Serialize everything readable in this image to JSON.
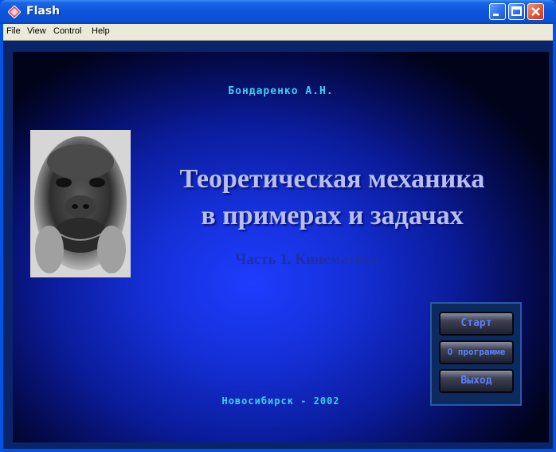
{
  "window": {
    "title": "Flash",
    "icon": "flash-app-icon",
    "controls": {
      "minimize": "minimize-icon",
      "maximize": "maximize-icon",
      "close": "close-icon"
    }
  },
  "menu": {
    "items": [
      {
        "label": "File"
      },
      {
        "label": "View"
      },
      {
        "label": "Control"
      },
      {
        "label": "Help"
      }
    ]
  },
  "content": {
    "author": "Бондаренко А.Н.",
    "title_line1": "Теоретическая механика",
    "title_line2": "в примерах и задачах",
    "subtitle": "Часть 1. Кинематика",
    "photo": "monkey-photo",
    "buttons": [
      {
        "label": "Старт"
      },
      {
        "label": "О программе"
      },
      {
        "label": "Выход"
      }
    ],
    "footer": "Новосибирск - 2002"
  },
  "colors": {
    "titlebar": "#0c55da",
    "stage_center": "#1f3cff",
    "stage_edge": "#01031a",
    "accent_text": "#3fd0f0",
    "heading_text": "#b6bff0",
    "button_text": "#5a7fff"
  }
}
